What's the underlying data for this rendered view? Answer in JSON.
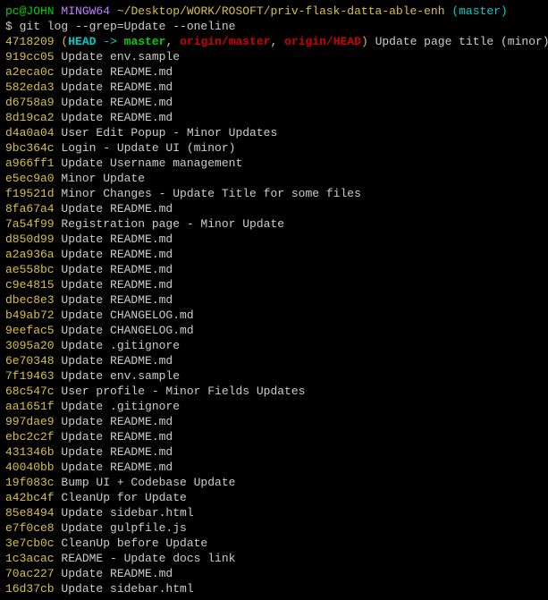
{
  "prompt": {
    "user": "pc@JOHN",
    "host": "MINGW64",
    "path": "~/Desktop/WORK/ROSOFT/priv-flask-datta-able-enh",
    "branch": "(master)"
  },
  "command": "$ git log --grep=Update --oneline",
  "refs": {
    "open": "(",
    "head": "HEAD",
    "arrow": " -> ",
    "local": "master",
    "sep1": ", ",
    "remote1": "origin/master",
    "sep2": ", ",
    "remote2": "origin/HEAD",
    "close": ")"
  },
  "first": {
    "hash": "4718209",
    "msg": " Update page title (minor)"
  },
  "commits": [
    {
      "hash": "919cc05",
      "msg": "Update env.sample"
    },
    {
      "hash": "a2eca0c",
      "msg": "Update README.md"
    },
    {
      "hash": "582eda3",
      "msg": "Update README.md"
    },
    {
      "hash": "d6758a9",
      "msg": "Update README.md"
    },
    {
      "hash": "8d19ca2",
      "msg": "Update README.md"
    },
    {
      "hash": "d4a0a04",
      "msg": "User Edit Popup - Minor Updates"
    },
    {
      "hash": "9bc364c",
      "msg": "Login - Update UI (minor)"
    },
    {
      "hash": "a966ff1",
      "msg": "Update Username management"
    },
    {
      "hash": "e5ec9a0",
      "msg": "Minor Update"
    },
    {
      "hash": "f19521d",
      "msg": "Minor Changes - Update Title for some files"
    },
    {
      "hash": "8fa67a4",
      "msg": "Update README.md"
    },
    {
      "hash": "7a54f99",
      "msg": "Registration page - Minor Update"
    },
    {
      "hash": "d850d99",
      "msg": "Update README.md"
    },
    {
      "hash": "a2a936a",
      "msg": "Update README.md"
    },
    {
      "hash": "ae558bc",
      "msg": "Update README.md"
    },
    {
      "hash": "c9e4815",
      "msg": "Update README.md"
    },
    {
      "hash": "dbec8e3",
      "msg": "Update README.md"
    },
    {
      "hash": "b49ab72",
      "msg": "Update CHANGELOG.md"
    },
    {
      "hash": "9eefac5",
      "msg": "Update CHANGELOG.md"
    },
    {
      "hash": "3095a20",
      "msg": "Update .gitignore"
    },
    {
      "hash": "6e70348",
      "msg": "Update README.md"
    },
    {
      "hash": "7f19463",
      "msg": "Update env.sample"
    },
    {
      "hash": "68c547c",
      "msg": "User profile - Minor Fields Updates"
    },
    {
      "hash": "aa1651f",
      "msg": "Update .gitignore"
    },
    {
      "hash": "997dae9",
      "msg": "Update README.md"
    },
    {
      "hash": "ebc2c2f",
      "msg": "Update README.md"
    },
    {
      "hash": "431346b",
      "msg": "Update README.md"
    },
    {
      "hash": "40040bb",
      "msg": "Update README.md"
    },
    {
      "hash": "19f083c",
      "msg": "Bump UI + Codebase Update"
    },
    {
      "hash": "a42bc4f",
      "msg": "CleanUp for Update"
    },
    {
      "hash": "85e8494",
      "msg": "Update sidebar.html"
    },
    {
      "hash": "e7f0ce8",
      "msg": "Update gulpfile.js"
    },
    {
      "hash": "3e7cb0c",
      "msg": "CleanUp before Update"
    },
    {
      "hash": "1c3acac",
      "msg": "README - Update docs link"
    },
    {
      "hash": "70ac227",
      "msg": "Update README.md"
    },
    {
      "hash": "16d37cb",
      "msg": "Update sidebar.html"
    }
  ]
}
